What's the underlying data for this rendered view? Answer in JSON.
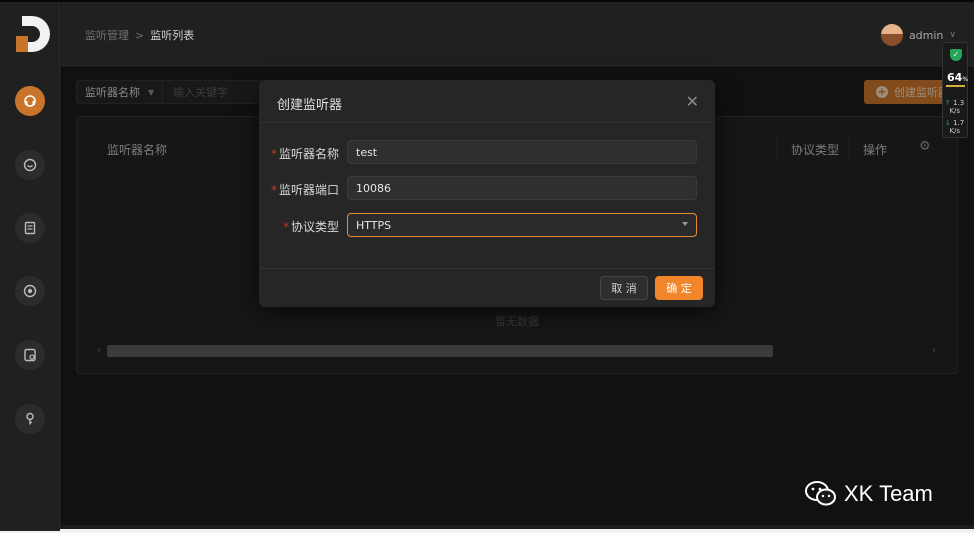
{
  "breadcrumb": {
    "parent": "监听管理",
    "separator": ">",
    "current": "监听列表"
  },
  "user": {
    "name": "admin"
  },
  "filter": {
    "field": "监听器名称",
    "placeholder": "输入关键字"
  },
  "toolbar": {
    "create_label": "创建监听器"
  },
  "table": {
    "columns": [
      "监听器名称",
      "协议类型",
      "操作"
    ],
    "empty_text": "暂无数据"
  },
  "modal": {
    "title": "创建监听器",
    "fields": [
      {
        "label": "监听器名称",
        "value": "test"
      },
      {
        "label": "监听器端口",
        "value": "10086"
      },
      {
        "label": "协议类型",
        "value": "HTTPS"
      }
    ],
    "cancel_label": "取 消",
    "ok_label": "确 定"
  },
  "widget": {
    "percent": "64",
    "percent_unit": "%",
    "up_speed": "1.3",
    "down_speed": "1.7",
    "unit": "K/s"
  },
  "watermark": {
    "text": "XK Team"
  },
  "colors": {
    "accent": "#f0852a",
    "sidebar_active": "#c8742a",
    "required": "#c0392b",
    "shield": "#23a55a"
  }
}
